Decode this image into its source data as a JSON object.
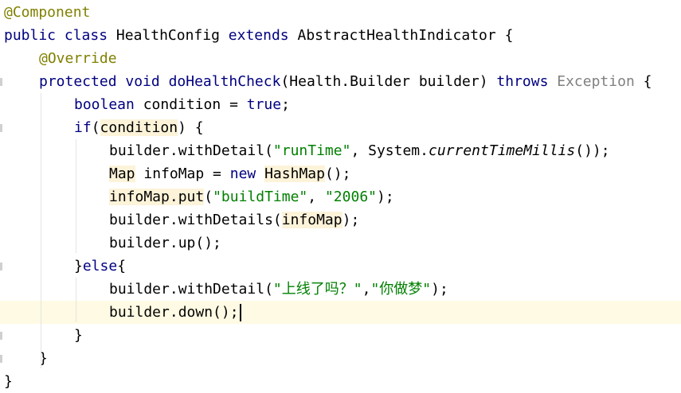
{
  "editor": {
    "lines": [
      {
        "indent": 0,
        "tokens": [
          {
            "t": "@Component",
            "c": "ann"
          }
        ]
      },
      {
        "indent": 0,
        "tokens": [
          {
            "t": "public ",
            "c": "kw"
          },
          {
            "t": "class ",
            "c": "kw"
          },
          {
            "t": "HealthConfig ",
            "c": "plain"
          },
          {
            "t": "extends ",
            "c": "kw"
          },
          {
            "t": "AbstractHealthIndicator {",
            "c": "plain"
          }
        ]
      },
      {
        "indent": 1,
        "tokens": [
          {
            "t": "@Override",
            "c": "ann"
          }
        ]
      },
      {
        "indent": 1,
        "tokens": [
          {
            "t": "protected ",
            "c": "kw"
          },
          {
            "t": "void ",
            "c": "kw"
          },
          {
            "t": "doHealthCheck",
            "c": "kw"
          },
          {
            "t": "(Health.Builder builder) ",
            "c": "plain"
          },
          {
            "t": "throws ",
            "c": "kw"
          },
          {
            "t": "Exception ",
            "c": "grey"
          },
          {
            "t": "{",
            "c": "plain"
          }
        ]
      },
      {
        "indent": 2,
        "tokens": [
          {
            "t": "boolean ",
            "c": "kw"
          },
          {
            "t": "condition = ",
            "c": "plain"
          },
          {
            "t": "true",
            "c": "kw"
          },
          {
            "t": ";",
            "c": "plain"
          }
        ]
      },
      {
        "indent": 2,
        "tokens": [
          {
            "t": "if",
            "c": "kw"
          },
          {
            "t": "(",
            "c": "plain"
          },
          {
            "t": "condition",
            "c": "plain",
            "hl": true
          },
          {
            "t": ") {",
            "c": "plain"
          }
        ]
      },
      {
        "indent": 3,
        "tokens": [
          {
            "t": "builder.withDetail(",
            "c": "plain"
          },
          {
            "t": "\"runTime\"",
            "c": "str"
          },
          {
            "t": ", System.",
            "c": "plain"
          },
          {
            "t": "currentTimeMillis",
            "c": "italic"
          },
          {
            "t": "());",
            "c": "plain"
          }
        ]
      },
      {
        "indent": 3,
        "tokens": [
          {
            "t": "Map",
            "c": "plain",
            "hl": true
          },
          {
            "t": " infoMap = ",
            "c": "plain"
          },
          {
            "t": "new ",
            "c": "kw"
          },
          {
            "t": "HashMap",
            "c": "plain",
            "hl": true
          },
          {
            "t": "();",
            "c": "plain"
          }
        ]
      },
      {
        "indent": 3,
        "tokens": [
          {
            "t": "infoMap.put",
            "c": "plain",
            "hl": true
          },
          {
            "t": "(",
            "c": "plain"
          },
          {
            "t": "\"buildTime\"",
            "c": "str"
          },
          {
            "t": ", ",
            "c": "plain"
          },
          {
            "t": "\"2006\"",
            "c": "str"
          },
          {
            "t": ");",
            "c": "plain"
          }
        ]
      },
      {
        "indent": 3,
        "tokens": [
          {
            "t": "builder.withDetails(",
            "c": "plain"
          },
          {
            "t": "infoMap",
            "c": "plain",
            "hl": true
          },
          {
            "t": ");",
            "c": "plain"
          }
        ]
      },
      {
        "indent": 3,
        "tokens": [
          {
            "t": "builder.up();",
            "c": "plain"
          }
        ]
      },
      {
        "indent": 2,
        "tokens": [
          {
            "t": "}",
            "c": "plain"
          },
          {
            "t": "else",
            "c": "kw"
          },
          {
            "t": "{",
            "c": "plain"
          }
        ]
      },
      {
        "indent": 3,
        "tokens": [
          {
            "t": "builder.withDetail(",
            "c": "plain"
          },
          {
            "t": "\"上线了吗？\"",
            "c": "str"
          },
          {
            "t": ",",
            "c": "plain"
          },
          {
            "t": "\"你做梦\"",
            "c": "str"
          },
          {
            "t": ");",
            "c": "plain"
          }
        ]
      },
      {
        "indent": 3,
        "current": true,
        "caret": true,
        "tokens": [
          {
            "t": "builder.down();",
            "c": "plain"
          }
        ]
      },
      {
        "indent": 2,
        "tokens": [
          {
            "t": "}",
            "c": "plain"
          }
        ]
      },
      {
        "indent": 1,
        "tokens": [
          {
            "t": "}",
            "c": "plain"
          }
        ]
      },
      {
        "indent": 0,
        "tokens": [
          {
            "t": "}",
            "c": "plain"
          }
        ]
      }
    ],
    "gutter_marks": [
      3,
      5,
      11,
      14,
      15
    ]
  }
}
